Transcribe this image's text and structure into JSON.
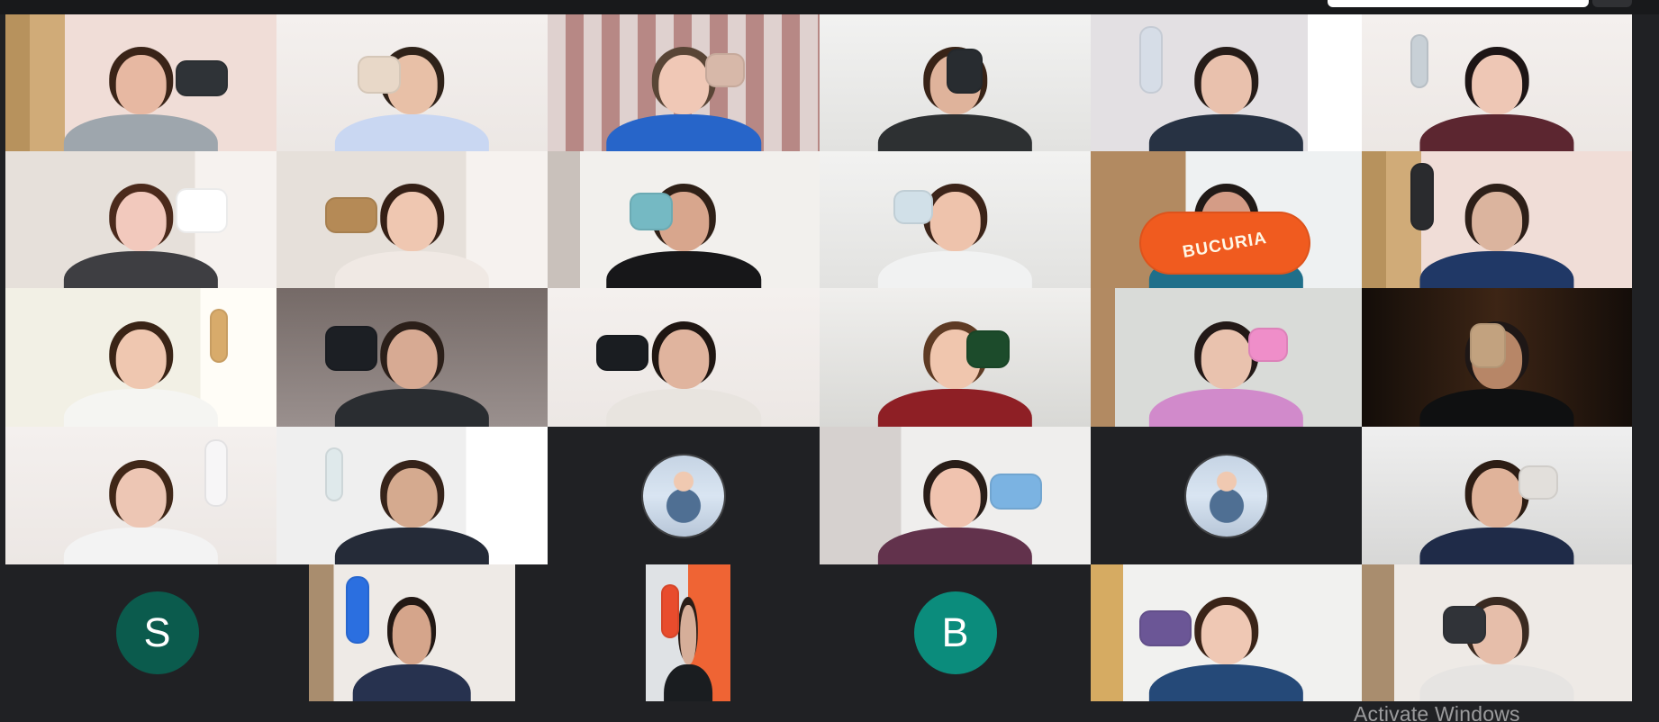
{
  "meeting": {
    "participants": [
      {
        "tone": "warm",
        "shirt": "#9ea6ad",
        "hair": "#3a2418",
        "skin": "#e7b8a2",
        "prop": "#2f3337"
      },
      {
        "tone": "light",
        "shirt": "#c9d7f2",
        "hair": "#2f2219",
        "skin": "#e8c0a7",
        "prop": "#e8d8c8"
      },
      {
        "tone": "pattern",
        "shirt": "#2765c9",
        "hair": "#594536",
        "skin": "#f0c8b6",
        "prop": "#d7b8a9"
      },
      {
        "tone": "bright",
        "shirt": "#2d3032",
        "hair": "#382317",
        "skin": "#dfb39b",
        "prop": "#282c30"
      },
      {
        "tone": "soft",
        "shirt": "#273243",
        "hair": "#261c18",
        "skin": "#e9c1ad",
        "prop": "#d6dde7"
      },
      {
        "tone": "light",
        "shirt": "#5c2630",
        "hair": "#1d1515",
        "skin": "#eec7b5",
        "prop": "#c8d0d6"
      },
      {
        "tone": "room",
        "shirt": "#3e3e42",
        "hair": "#4b2a1c",
        "skin": "#f2c9bd",
        "prop": "#ffffff"
      },
      {
        "tone": "room",
        "shirt": "#f0e9e4",
        "hair": "#352016",
        "skin": "#efc7b1",
        "prop": "#b58a56"
      },
      {
        "tone": "group",
        "shirt": "#171719",
        "hair": "#2f2017",
        "skin": "#d8a68d",
        "prop": "#75b9c3"
      },
      {
        "tone": "bright",
        "shirt": "#f1f2f2",
        "hair": "#3c2419",
        "skin": "#eec3ac",
        "prop": "#d1e0e8"
      },
      {
        "tone": "candy",
        "shirt": "#1f6f8a",
        "hair": "#211a17",
        "skin": "#d49c86",
        "prop": "#f05b1f",
        "prop_text": "BUCURIA"
      },
      {
        "tone": "warm",
        "shirt": "#203866",
        "hair": "#2d1f18",
        "skin": "#dbb49e",
        "prop": "#2a2b2e"
      },
      {
        "tone": "window",
        "shirt": "#f5f5f2",
        "hair": "#3a2416",
        "skin": "#efc7b0",
        "prop": "#d8ab6b"
      },
      {
        "tone": "dark",
        "shirt": "#2a2d31",
        "hair": "#2b1f19",
        "skin": "#d7aa93",
        "prop": "#1c1f24"
      },
      {
        "tone": "light",
        "shirt": "#e8e4df",
        "hair": "#1f1612",
        "skin": "#e0b49e",
        "prop": "#1a1d21"
      },
      {
        "tone": "red",
        "shirt": "#8e1f25",
        "hair": "#5e3b24",
        "skin": "#f0c6ae",
        "prop": "#1c4b2b"
      },
      {
        "tone": "owl",
        "shirt": "#d18acb",
        "hair": "#231917",
        "skin": "#e9c2ae",
        "prop": "#ef8ec9"
      },
      {
        "tone": "night",
        "shirt": "#0f1011",
        "hair": "#1e1716",
        "skin": "#b78667",
        "prop": "#c2a27f"
      },
      {
        "tone": "light",
        "shirt": "#f3f3f3",
        "hair": "#402718",
        "skin": "#edc6b4",
        "prop": "#f7f6f7"
      },
      {
        "tone": "posters",
        "shirt": "#252b38",
        "hair": "#36231a",
        "skin": "#d5aa8f",
        "prop": "#dfe9eb"
      },
      {
        "tone": "avatar_photo"
      },
      {
        "tone": "bottle",
        "shirt": "#62324c",
        "hair": "#291d18",
        "skin": "#f0c3af",
        "prop": "#7bb3e2"
      },
      {
        "tone": "avatar_photo"
      },
      {
        "tone": "plain",
        "shirt": "#1f2b48",
        "hair": "#2d1d14",
        "skin": "#e0b39a",
        "prop": "#e2dfdb"
      },
      {
        "tone": "letter",
        "letter": "S",
        "color": "#0b5b4d"
      },
      {
        "tone": "headset",
        "shirt": "#27324f",
        "hair": "#221814",
        "skin": "#d5a58b",
        "prop": "#2b6fe0"
      },
      {
        "tone": "small_video",
        "shirt": "#1a1d20",
        "hair": "#2a1d17",
        "skin": "#d6ae99",
        "prop": "#e84c2d"
      },
      {
        "tone": "letter",
        "letter": "B",
        "color": "#0b8c7c"
      },
      {
        "tone": "snack",
        "shirt": "#254978",
        "hair": "#3a2418",
        "skin": "#efc8b4",
        "prop": "#6b5696"
      },
      {
        "tone": "headset",
        "shirt": "#e6e4e2",
        "hair": "#3a2a21",
        "skin": "#e6beaa",
        "prop": "#303338"
      }
    ],
    "watermark": "Activate Windows"
  }
}
